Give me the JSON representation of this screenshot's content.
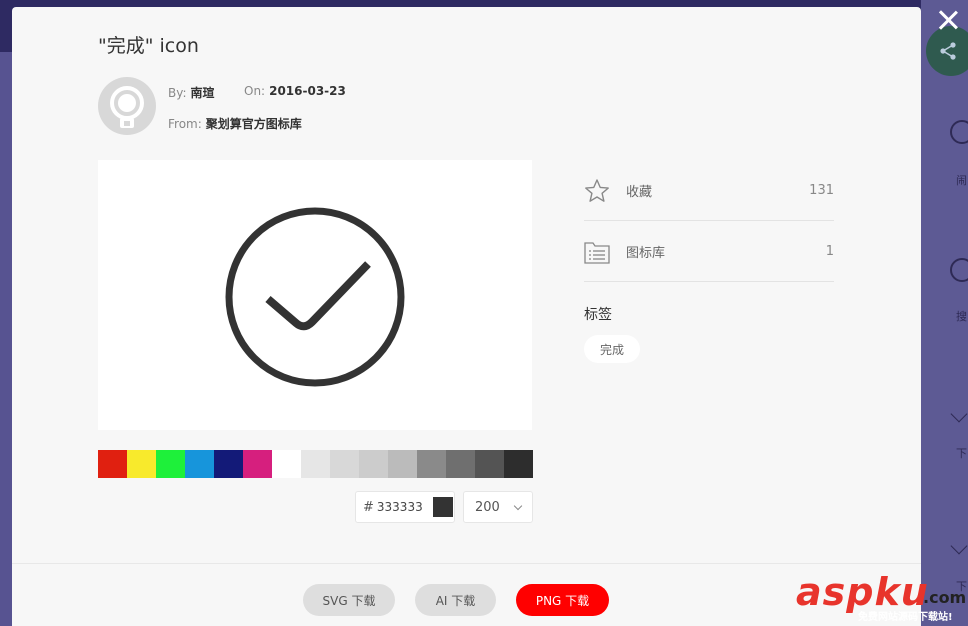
{
  "modal": {
    "title": "\"完成\" icon",
    "author": {
      "by_label": "By:",
      "by_value": "南瑄",
      "on_label": "On:",
      "on_value": "2016-03-23",
      "from_label": "From:",
      "from_value": "聚划算官方图标库"
    },
    "color_input": {
      "hash": "#",
      "value": "333333",
      "color": "#333333"
    },
    "size_select": {
      "value": "200"
    },
    "swatches": [
      "#e02010",
      "#f8ea2c",
      "#1ef03a",
      "#1795db",
      "#131a78",
      "#d61f7e",
      "#ffffff",
      "#e6e6e6",
      "#d8d8d8",
      "#cccccc",
      "#bbbbbb",
      "#8a8a8a",
      "#6f6f6f",
      "#545454",
      "#2d2d2d"
    ],
    "stats": [
      {
        "icon": "star-icon",
        "label": "收藏",
        "value": "131"
      },
      {
        "icon": "folder-list-icon",
        "label": "图标库",
        "value": "1"
      }
    ],
    "tags": {
      "title": "标签",
      "items": [
        "完成"
      ]
    },
    "buttons": {
      "svg": "SVG 下载",
      "ai": "AI 下载",
      "png": "PNG 下载"
    },
    "accent_color": "#ff0000"
  },
  "sidebar": {
    "labels": [
      "闹",
      "搜",
      "下",
      "下"
    ]
  },
  "watermark": {
    "brand": "aspku",
    "tld": ".com",
    "slogan": "免费网站源码下载站!"
  }
}
